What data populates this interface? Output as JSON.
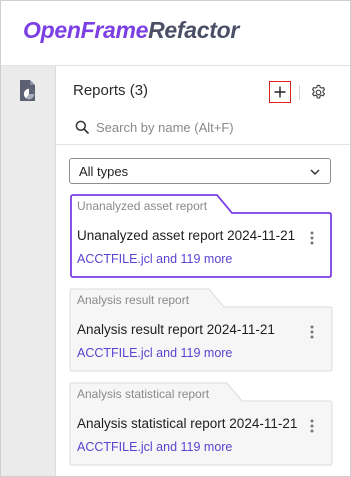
{
  "header": {
    "brand": "OpenFrame",
    "product": "Refactor"
  },
  "rail": {
    "icon": "report-document-icon"
  },
  "panel": {
    "title": "Reports",
    "count": "(3)",
    "add_icon": "plus-icon",
    "settings_icon": "gear-icon"
  },
  "search": {
    "placeholder": "Search by name (Alt+F)",
    "value": ""
  },
  "filter": {
    "selected": "All types"
  },
  "reports": [
    {
      "type": "Unanalyzed asset report",
      "title": "Unanalyzed asset report 2024-11-21",
      "files": "ACCTFILE.jcl and 119 more",
      "selected": true
    },
    {
      "type": "Analysis result report",
      "title": "Analysis result report 2024-11-21",
      "files": "ACCTFILE.jcl and 119 more",
      "selected": false
    },
    {
      "type": "Analysis statistical report",
      "title": "Analysis statistical report 2024-11-21",
      "files": "ACCTFILE.jcl and 119 more",
      "selected": false
    }
  ],
  "colors": {
    "brand": "#7b3fe4",
    "product": "#4a4f66",
    "accent": "#7b3fe4",
    "link": "#5a43d0",
    "highlight": "#e0241b"
  }
}
